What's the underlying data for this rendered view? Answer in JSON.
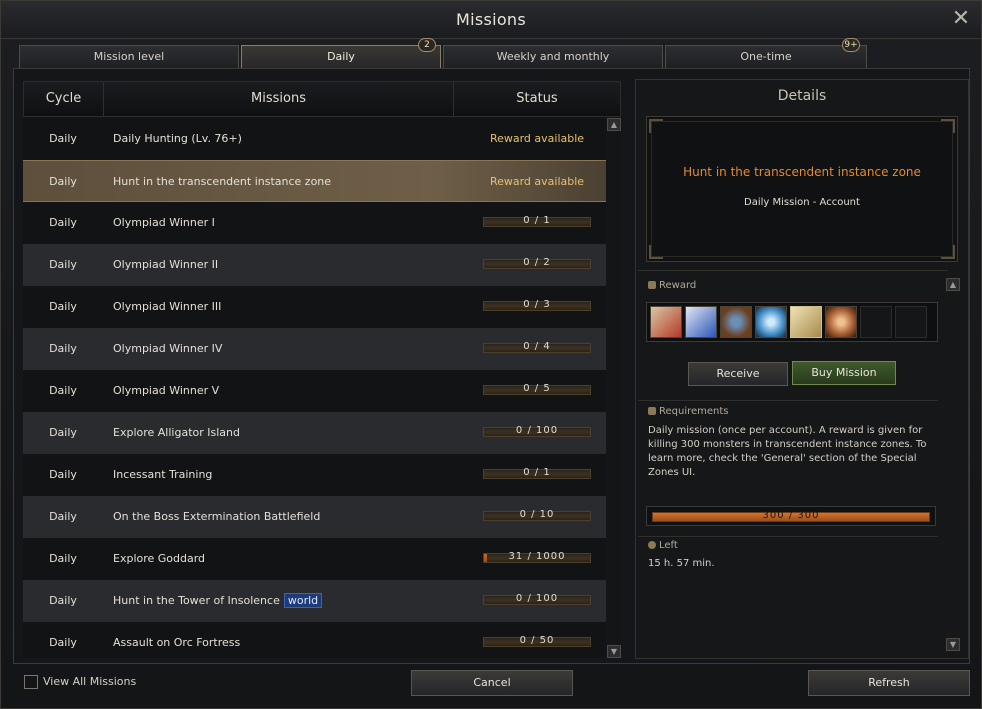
{
  "window": {
    "title": "Missions"
  },
  "tabs": [
    {
      "label": "Mission level",
      "badge": ""
    },
    {
      "label": "Daily",
      "badge": "2"
    },
    {
      "label": "Weekly and monthly",
      "badge": ""
    },
    {
      "label": "One-time",
      "badge": "9+"
    }
  ],
  "list": {
    "headers": {
      "cycle": "Cycle",
      "missions": "Missions",
      "status": "Status"
    },
    "rows": [
      {
        "cycle": "Daily",
        "name": "Daily Hunting (Lv. 76+)",
        "status": "Reward available"
      },
      {
        "cycle": "Daily",
        "name": "Hunt in the transcendent instance zone",
        "status": "Reward available"
      },
      {
        "cycle": "Daily",
        "name": "Olympiad Winner I",
        "progress": "0 / 1",
        "fraction": 0
      },
      {
        "cycle": "Daily",
        "name": "Olympiad Winner II",
        "progress": "0 / 2",
        "fraction": 0
      },
      {
        "cycle": "Daily",
        "name": "Olympiad Winner III",
        "progress": "0 / 3",
        "fraction": 0
      },
      {
        "cycle": "Daily",
        "name": "Olympiad Winner IV",
        "progress": "0 / 4",
        "fraction": 0
      },
      {
        "cycle": "Daily",
        "name": "Olympiad Winner V",
        "progress": "0 / 5",
        "fraction": 0
      },
      {
        "cycle": "Daily",
        "name": "Explore Alligator Island",
        "progress": "0 / 100",
        "fraction": 0
      },
      {
        "cycle": "Daily",
        "name": "Incessant Training",
        "progress": "0 / 1",
        "fraction": 0
      },
      {
        "cycle": "Daily",
        "name": "On the Boss Extermination Battlefield",
        "progress": "0 / 10",
        "fraction": 0
      },
      {
        "cycle": "Daily",
        "name": "Explore Goddard",
        "progress": "31 / 1000",
        "fraction": 0.031
      },
      {
        "cycle": "Daily",
        "name": "Hunt in the Tower of Insolence",
        "tag": "world",
        "progress": "0 / 100",
        "fraction": 0
      },
      {
        "cycle": "Daily",
        "name": "Assault on Orc Fortress",
        "progress": "0 / 50",
        "fraction": 0
      }
    ]
  },
  "details": {
    "title": "Details",
    "mission_title": "Hunt in the transcendent instance zone",
    "mission_sub": "Daily Mission  -  Account",
    "reward_label": "Reward",
    "rewards": [
      "scroll-red-icon",
      "scroll-blue-icon",
      "chest-icon",
      "crystal-icon",
      "parchment-icon",
      "emblem-icon"
    ],
    "receive": "Receive",
    "buy": "Buy Mission",
    "requirements_label": "Requirements",
    "requirements": "Daily mission (once per account). A reward is given for killing 300 monsters in transcendent instance zones. To learn more, check the 'General' section of the Special Zones UI.",
    "progress": "300 / 300",
    "progress_fraction": 1.0,
    "left_label": "Left",
    "left_value": "15 h. 57 min."
  },
  "footer": {
    "view_all": "View All Missions",
    "cancel": "Cancel",
    "refresh": "Refresh"
  }
}
